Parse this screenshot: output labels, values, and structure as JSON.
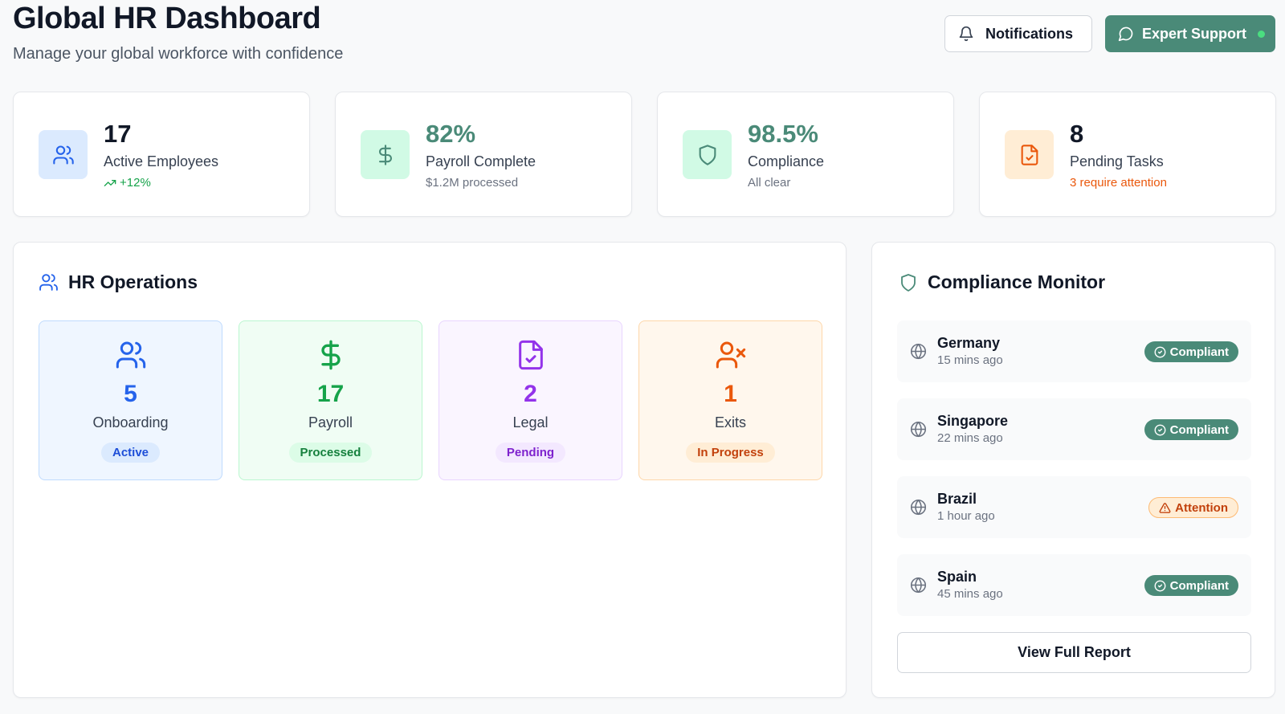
{
  "header": {
    "title": "Global HR Dashboard",
    "subtitle": "Manage your global workforce with confidence",
    "notifications_label": "Notifications",
    "support_label": "Expert Support"
  },
  "stats": [
    {
      "value": "17",
      "label": "Active Employees",
      "sub": "+12%",
      "icon": "users-icon",
      "color": "#2563eb"
    },
    {
      "value": "82%",
      "label": "Payroll Complete",
      "sub": "$1.2M processed",
      "icon": "dollar-icon",
      "color": "#4a8a78"
    },
    {
      "value": "98.5%",
      "label": "Compliance",
      "sub": "All clear",
      "icon": "shield-icon",
      "color": "#4a8a78"
    },
    {
      "value": "8",
      "label": "Pending Tasks",
      "sub": "3 require attention",
      "icon": "file-check-icon",
      "color": "#ea580c"
    }
  ],
  "operations": {
    "title": "HR Operations",
    "cards": [
      {
        "value": "5",
        "label": "Onboarding",
        "badge": "Active",
        "icon": "users-icon",
        "color": "#2563eb"
      },
      {
        "value": "17",
        "label": "Payroll",
        "badge": "Processed",
        "icon": "dollar-icon",
        "color": "#16a34a"
      },
      {
        "value": "2",
        "label": "Legal",
        "badge": "Pending",
        "icon": "file-check-icon",
        "color": "#9333ea"
      },
      {
        "value": "1",
        "label": "Exits",
        "badge": "In Progress",
        "icon": "user-x-icon",
        "color": "#ea580c"
      }
    ]
  },
  "compliance": {
    "title": "Compliance Monitor",
    "countries": [
      {
        "name": "Germany",
        "time": "15 mins ago",
        "status": "Compliant"
      },
      {
        "name": "Singapore",
        "time": "22 mins ago",
        "status": "Compliant"
      },
      {
        "name": "Brazil",
        "time": "1 hour ago",
        "status": "Attention"
      },
      {
        "name": "Spain",
        "time": "45 mins ago",
        "status": "Compliant"
      }
    ],
    "report_button": "View Full Report"
  }
}
